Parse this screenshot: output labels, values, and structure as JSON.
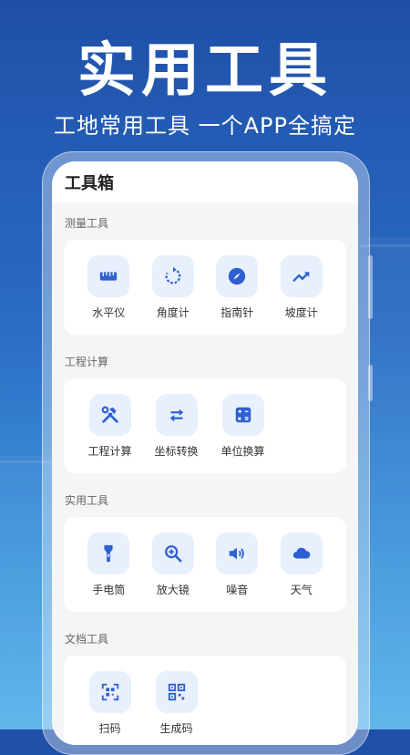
{
  "hero": {
    "title": "实用工具",
    "subtitle": "工地常用工具 一个APP全搞定"
  },
  "app": {
    "title": "工具箱"
  },
  "sections": [
    {
      "title": "测量工具",
      "tools": [
        {
          "label": "水平仪",
          "icon": "ruler-icon"
        },
        {
          "label": "角度计",
          "icon": "rotate-icon"
        },
        {
          "label": "指南针",
          "icon": "compass-icon"
        },
        {
          "label": "坡度计",
          "icon": "trending-up-icon"
        }
      ]
    },
    {
      "title": "工程计算",
      "tools": [
        {
          "label": "工程计算",
          "icon": "tools-icon"
        },
        {
          "label": "坐标转换",
          "icon": "swap-arrows-icon"
        },
        {
          "label": "单位换算",
          "icon": "calculator-icon"
        }
      ]
    },
    {
      "title": "实用工具",
      "tools": [
        {
          "label": "手电筒",
          "icon": "flashlight-icon"
        },
        {
          "label": "放大镜",
          "icon": "zoom-in-icon"
        },
        {
          "label": "噪音",
          "icon": "volume-icon"
        },
        {
          "label": "天气",
          "icon": "cloud-icon"
        }
      ]
    },
    {
      "title": "文档工具",
      "tools": [
        {
          "label": "扫码",
          "icon": "scan-qr-icon"
        },
        {
          "label": "生成码",
          "icon": "qr-code-icon"
        }
      ]
    }
  ],
  "colors": {
    "accent": "#2f5fd0",
    "icon_bg": "#e8effd",
    "background_top": "#1f4fa8",
    "background_bottom": "#58b3ea"
  }
}
